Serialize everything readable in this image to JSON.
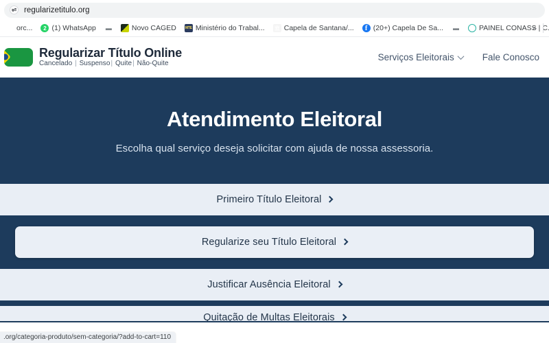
{
  "browser": {
    "omnibox": {
      "url": "regularizetitulo.org",
      "icon": "tune-icon"
    },
    "bookmarks": [
      {
        "label": "orc...",
        "icon": "generic-favicon",
        "kind": "generic"
      },
      {
        "label": "(1) WhatsApp",
        "icon": "whatsapp-icon",
        "kind": "whatsapp",
        "badge": "2"
      },
      {
        "label": "",
        "icon": "dots-icon",
        "kind": "dots"
      },
      {
        "label": "Novo CAGED",
        "icon": "caged-icon",
        "kind": "caged"
      },
      {
        "label": "Ministério do Trabal...",
        "icon": "ministerio-trabalho-icon",
        "kind": "trabalho"
      },
      {
        "label": "Capela de Santana/...",
        "icon": "capela-icon",
        "kind": "capela"
      },
      {
        "label": "(20+) Capela De Sa...",
        "icon": "facebook-icon",
        "kind": "facebook"
      },
      {
        "label": "",
        "icon": "dots-icon",
        "kind": "dots"
      },
      {
        "label": "PAINEL CONASS | C...",
        "icon": "conass-icon",
        "kind": "conass"
      }
    ],
    "overflow_label": "»",
    "status_url": ".org/categoria-produto/sem-categoria/?add-to-cart=110"
  },
  "site": {
    "brand": {
      "title": "Regularizar Título Online",
      "subtitle_parts": [
        "Cancelado",
        "Suspenso",
        "Quite",
        "Não-Quite"
      ],
      "flag_icon": "brazil-flag-icon"
    },
    "nav": [
      {
        "label": "Serviços Eleitorais",
        "has_dropdown": true,
        "icon": "chevron-down-icon"
      },
      {
        "label": "Fale Conosco",
        "has_dropdown": false
      }
    ]
  },
  "hero": {
    "title": "Atendimento Eleitoral",
    "subtitle": "Escolha qual serviço deseja solicitar com ajuda de nossa assessoria."
  },
  "services": [
    {
      "label": "Primeiro Título Eleitoral",
      "style": "flat",
      "icon": "chevron-right-icon"
    },
    {
      "label": "Regularize seu Título Eleitoral",
      "style": "card",
      "icon": "chevron-right-icon"
    },
    {
      "label": "Justificar Ausência Eleitoral",
      "style": "flat",
      "icon": "chevron-right-icon"
    },
    {
      "label": "Quitação de Multas Eleitorais",
      "style": "partial",
      "icon": "chevron-right-icon"
    }
  ],
  "colors": {
    "navy": "#1d3b5c",
    "card_bg": "#e9eef5",
    "brand_green": "#1a9641",
    "brand_yellow": "#f5d800",
    "brand_blue": "#1c4b8f",
    "whatsapp_green": "#25d366",
    "facebook_blue": "#1877f2"
  }
}
